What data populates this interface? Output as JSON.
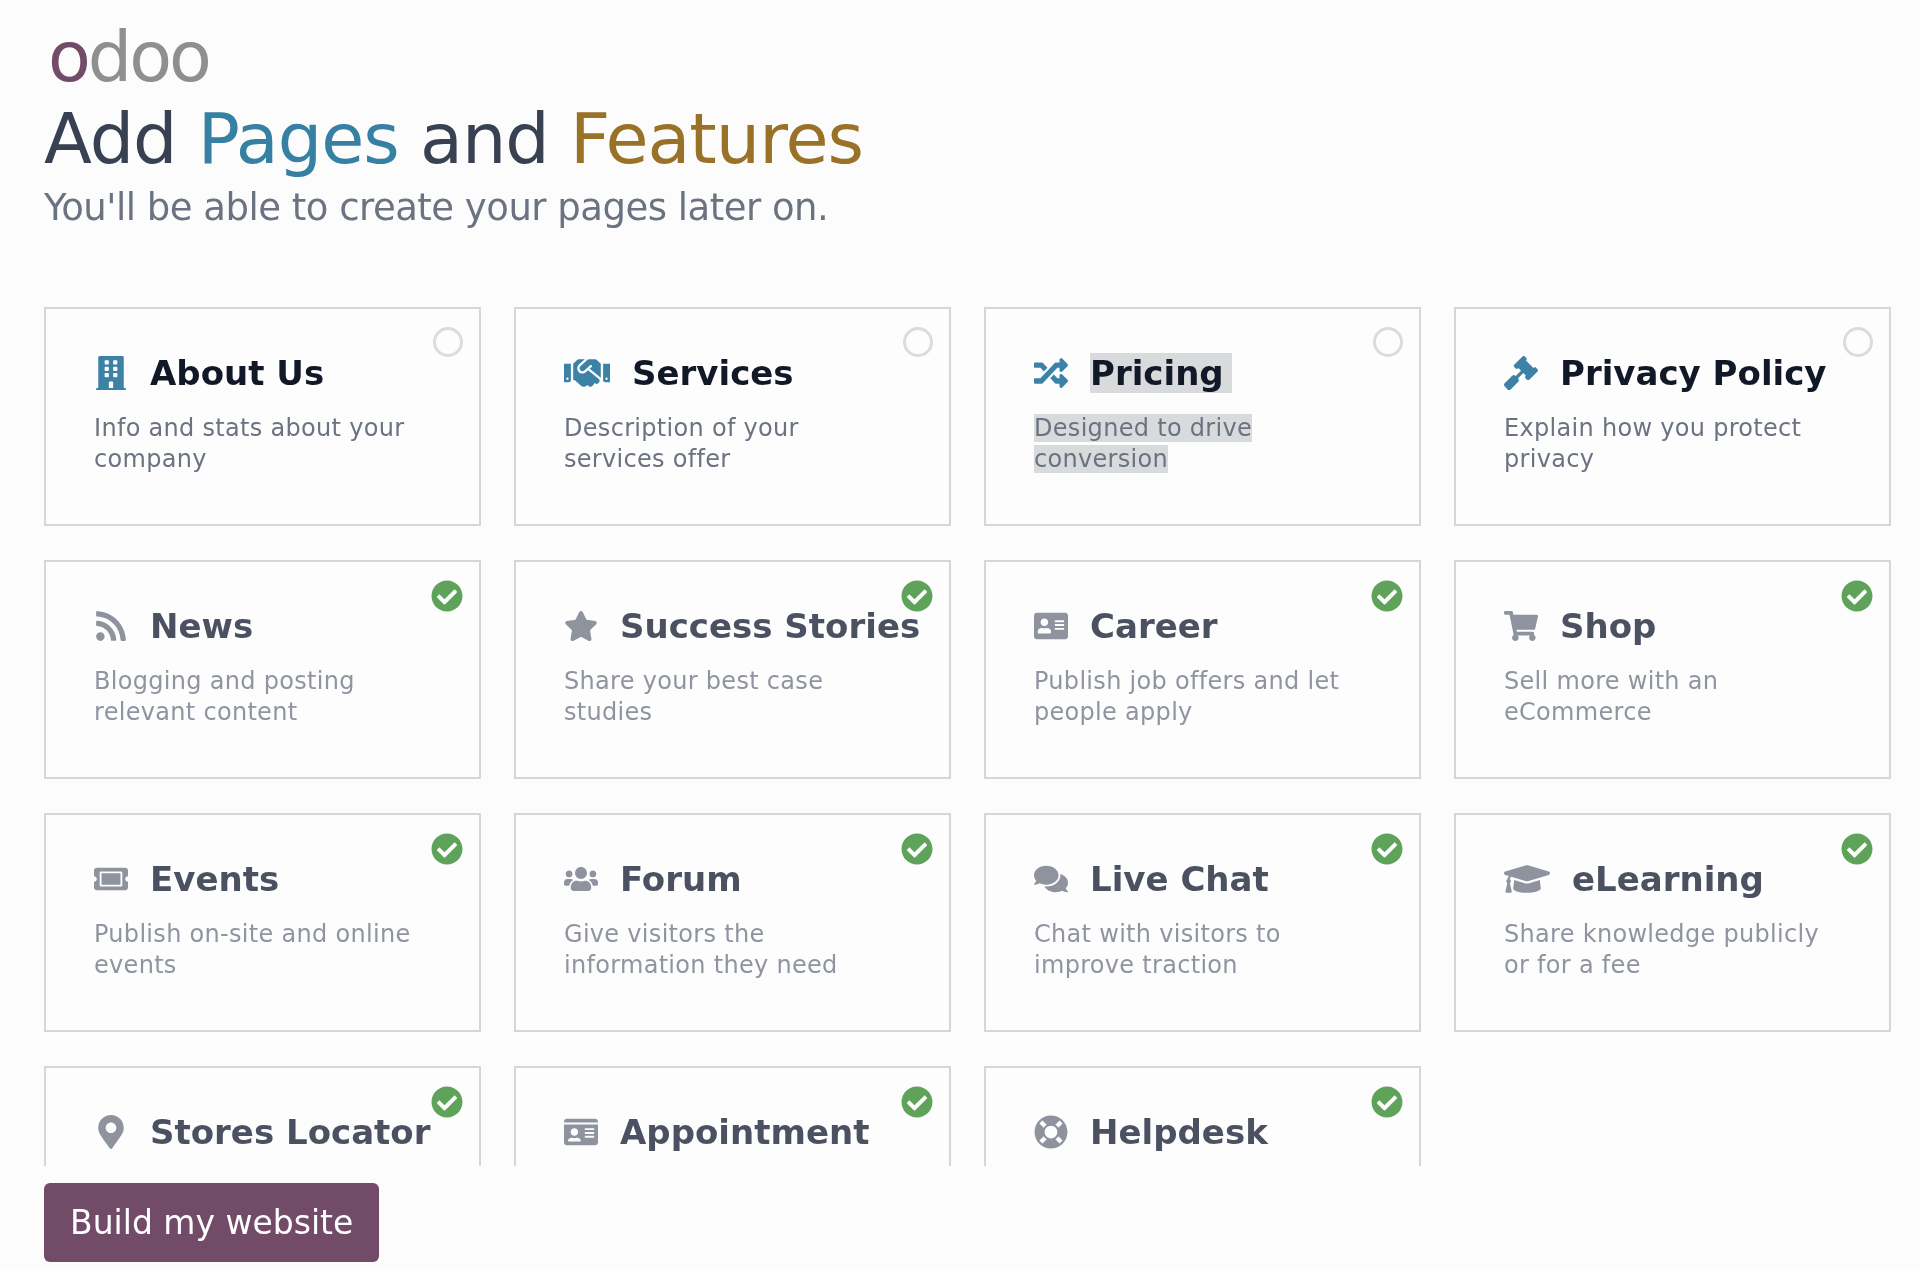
{
  "logo": "odoo",
  "title": [
    {
      "text": "Add",
      "kind": "plain"
    },
    {
      "text": "Pages",
      "kind": "primary"
    },
    {
      "text": "and",
      "kind": "plain"
    },
    {
      "text": "Features",
      "kind": "secondary"
    }
  ],
  "subtitle": "You'll be able to create your pages later on.",
  "features": [
    {
      "title": "About Us",
      "description": "Info and stats about your company",
      "installed": false,
      "highlighted": false
    },
    {
      "title": "Services",
      "description": "Description of your services offer",
      "installed": false,
      "highlighted": false
    },
    {
      "title": "Pricing",
      "description": "Designed to drive conversion",
      "installed": false,
      "highlighted": true
    },
    {
      "title": "Privacy Policy",
      "description": "Explain how you protect privacy",
      "installed": false,
      "highlighted": false
    },
    {
      "title": "News",
      "description": "Blogging and posting relevant content",
      "installed": true,
      "highlighted": false
    },
    {
      "title": "Success Stories",
      "description": "Share your best case studies",
      "installed": true,
      "highlighted": false
    },
    {
      "title": "Career",
      "description": "Publish job offers and let people apply",
      "installed": true,
      "highlighted": false
    },
    {
      "title": "Shop",
      "description": "Sell more with an eCommerce",
      "installed": true,
      "highlighted": false
    },
    {
      "title": "Events",
      "description": "Publish on-site and online events",
      "installed": true,
      "highlighted": false
    },
    {
      "title": "Forum",
      "description": "Give visitors the information they need",
      "installed": true,
      "highlighted": false
    },
    {
      "title": "Live Chat",
      "description": "Chat with visitors to improve traction",
      "installed": true,
      "highlighted": false
    },
    {
      "title": "eLearning",
      "description": "Share knowledge publicly or for a fee",
      "installed": true,
      "highlighted": false
    },
    {
      "title": "Stores Locator",
      "installed": true,
      "highlighted": false
    },
    {
      "title": "Appointment",
      "installed": true,
      "highlighted": false
    },
    {
      "title": "Helpdesk",
      "installed": true,
      "highlighted": false
    }
  ],
  "button": "Build my website"
}
